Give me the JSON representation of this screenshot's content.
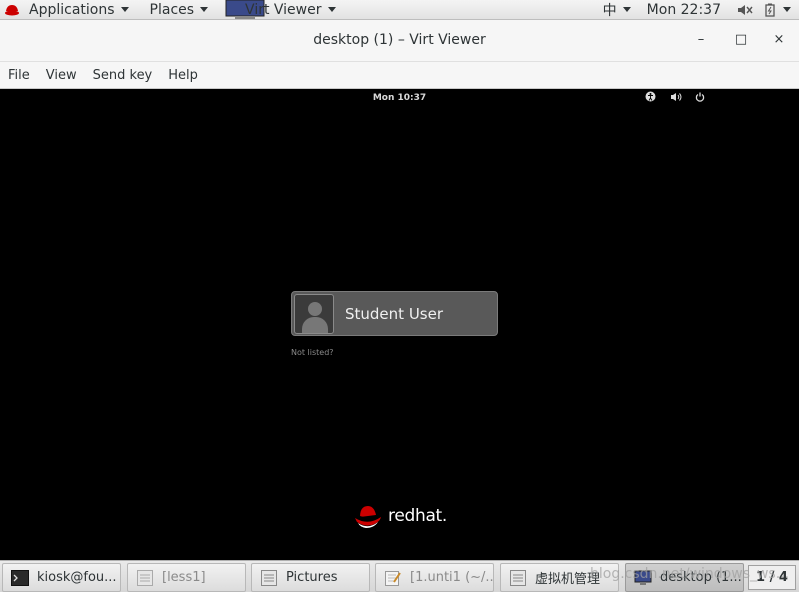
{
  "topbar": {
    "applications_label": "Applications",
    "places_label": "Places",
    "active_app_label": "Virt Viewer",
    "input_method": "中",
    "clock": "Mon 22:37"
  },
  "window": {
    "title": "desktop (1) – Virt Viewer",
    "menu": [
      "File",
      "View",
      "Send key",
      "Help"
    ]
  },
  "guest": {
    "clock": "Mon 10:37",
    "user_name": "Student User",
    "not_listed": "Not listed?",
    "logo_text": "redhat."
  },
  "taskbar": {
    "items": [
      {
        "label": "kiosk@fou...",
        "state": "normal",
        "icon": "terminal-icon"
      },
      {
        "label": "[less1]",
        "state": "minimized",
        "icon": "window-icon"
      },
      {
        "label": "Pictures",
        "state": "normal",
        "icon": "folder-window-icon"
      },
      {
        "label": "[1.unti1 (~/...",
        "state": "minimized",
        "icon": "text-editor-icon"
      },
      {
        "label": "虚拟机管理",
        "state": "normal",
        "icon": "window-icon"
      },
      {
        "label": "desktop (1...",
        "state": "active",
        "icon": "monitor-icon"
      }
    ],
    "workspace": "1 / 4"
  },
  "watermark": "blog.csdn.net/windows_ws..."
}
